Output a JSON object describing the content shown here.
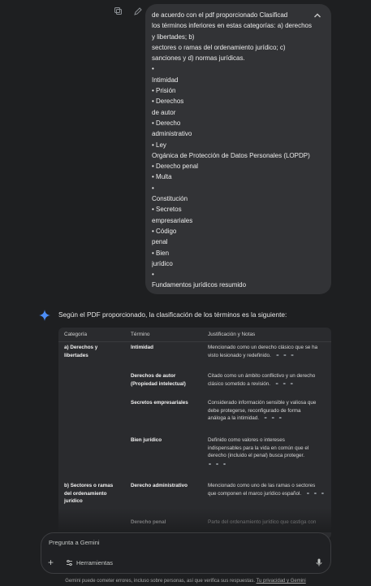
{
  "user_message": {
    "lines": [
      "de acuerdo con el pdf proporcionado Clasificad",
      "los términos inferiores en estas categorías: a) derechos",
      "y libertades; b)",
      "sectores o ramas del ordenamiento jurídico; c)",
      "sanciones y d) normas jurídicas.",
      "•",
      "Intimidad",
      "  • Prisión",
      "• Derechos",
      "de autor",
      "• Derecho",
      "administrativo",
      "• Ley",
      "Orgánica de Protección de Datos Personales (LOPDP)",
      "  • Derecho penal",
      "• Multa",
      "•",
      "Constitución",
      "• Secretos",
      "empresariales",
      "• Código",
      "penal",
      "• Bien",
      "jurídico",
      "•",
      "Fundamentos jurídicos resumido"
    ],
    "collapse_icon": "chevron-up-icon"
  },
  "response": {
    "intro": "Según el PDF proporcionado, la clasificación de los términos es la siguiente:",
    "table": {
      "headers": [
        "Categoría",
        "Término",
        "Justificación y Notas"
      ],
      "rows": [
        {
          "category": [
            "a) Derechos y",
            "libertades"
          ],
          "term": [
            "Intimidad"
          ],
          "just": [
            "Mencionado como un derecho clásico que se ha",
            "visto lesionado y redefinido."
          ]
        },
        {
          "category": [],
          "term": [
            "Derechos de autor",
            "(Propiedad intelectual)"
          ],
          "just": [
            "Citado como un ámbito conflictivo y un derecho",
            "clásico sometido a revisión."
          ]
        },
        {
          "category": [],
          "term": [
            "Secretos empresariales"
          ],
          "just": [
            "Considerado información sensible y valiosa que",
            "debe protegerse, reconfigurado de forma",
            "análoga a la intimidad."
          ]
        },
        {
          "category": [],
          "term": [
            "Bien jurídico"
          ],
          "just": [
            "Definido como valores o intereses",
            "indispensables para la vida en común que el",
            "derecho (incluido el penal) busca proteger."
          ]
        },
        {
          "category": [
            "b) Sectores o ramas",
            "del ordenamiento",
            "jurídico"
          ],
          "term": [
            "Derecho administrativo"
          ],
          "just": [
            "Mencionado como uno de las ramas o sectores",
            "que componen el marco jurídico español."
          ]
        },
        {
          "category": [],
          "term": [
            "Derecho penal"
          ],
          "just": [
            "Parte del ordenamiento jurídico que castiga con"
          ]
        }
      ]
    }
  },
  "composer": {
    "placeholder": "Pregunta a Gemini",
    "tools_label": "Herramientas"
  },
  "disclaimer": {
    "text": "Gemini puede cometer errores, incluso sobre personas, así que verifica sus respuestas.",
    "link": "Tu privacidad y Gemini"
  }
}
